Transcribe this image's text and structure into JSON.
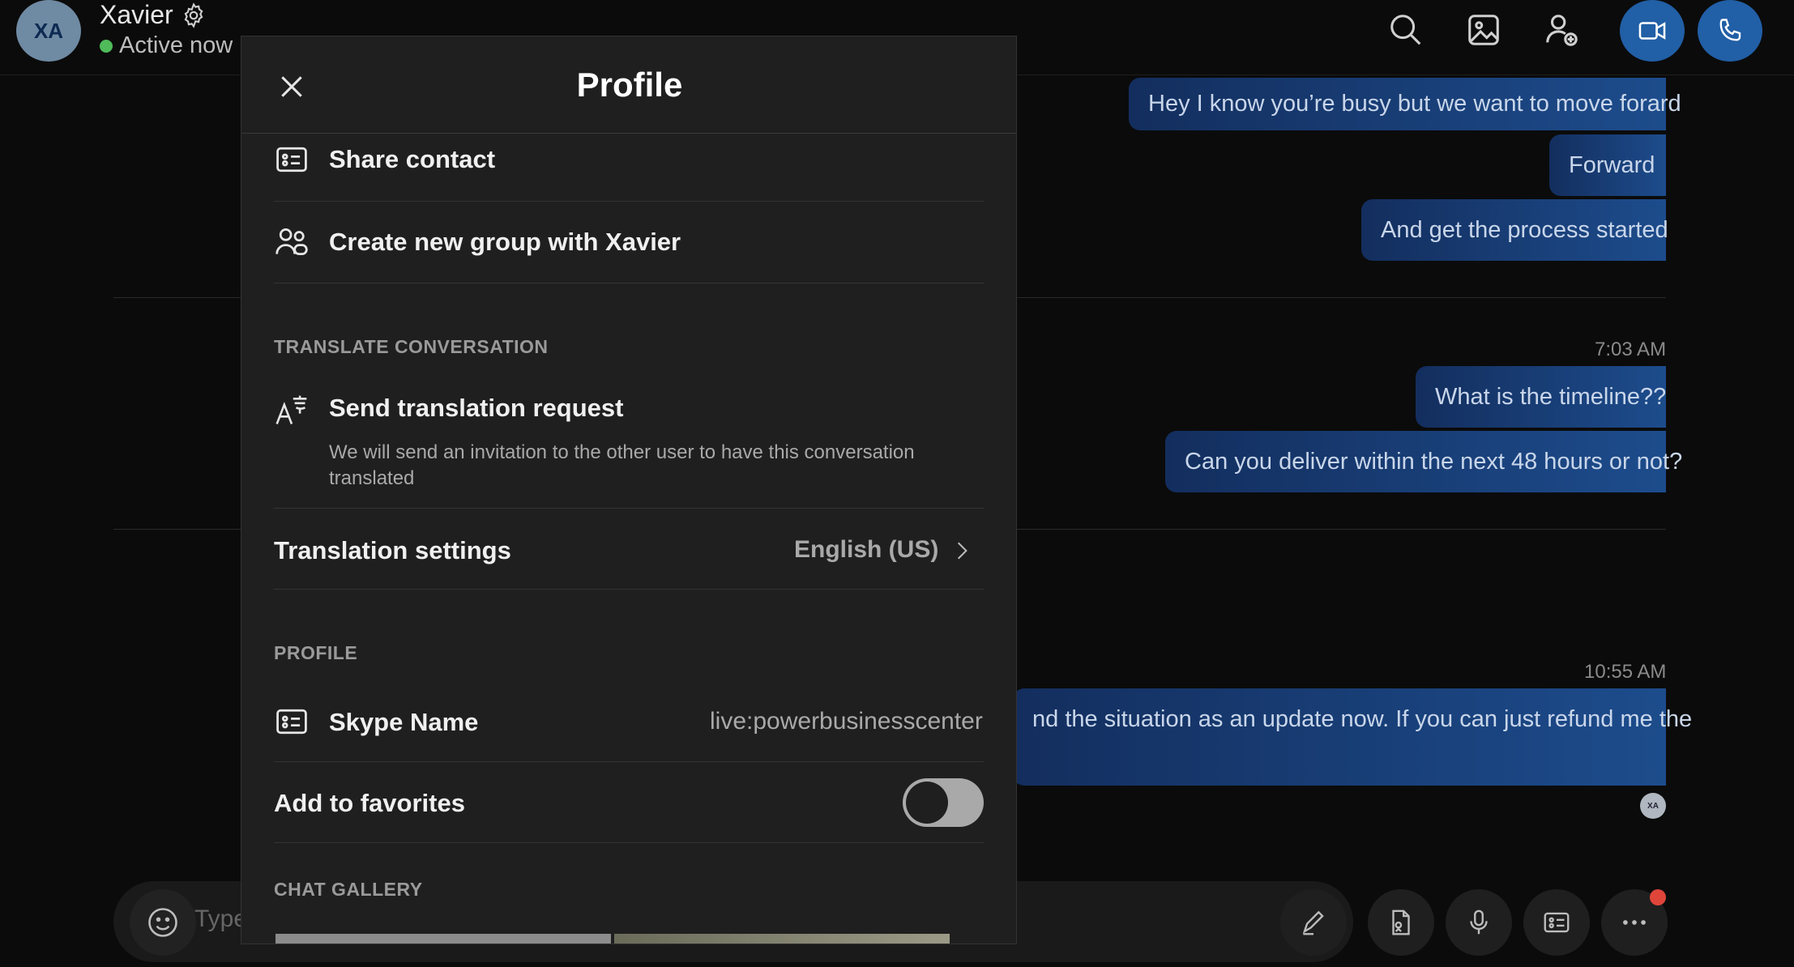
{
  "header": {
    "avatar_initials": "XA",
    "contact_name": "Xavier",
    "status": "Active now",
    "status_color": "#4fbb5a"
  },
  "messages": [
    {
      "text": "Hey I know you’re busy but we want to move forard"
    },
    {
      "text": "Forward"
    },
    {
      "text": "And get the process started"
    },
    {
      "timestamp": "7:03 AM"
    },
    {
      "text": "What is the timeline??"
    },
    {
      "text": "Can you deliver within the next 48 hours or not?"
    },
    {
      "timestamp": "10:55 AM"
    },
    {
      "text": "nd the situation as an update now. If you can just refund me the"
    }
  ],
  "mini_avatar": "XA",
  "composer": {
    "placeholder": "Type"
  },
  "modal": {
    "title": "Profile",
    "share_contact": "Share contact",
    "create_group": "Create new group with Xavier",
    "translate_section": "TRANSLATE CONVERSATION",
    "send_translation": "Send translation request",
    "send_translation_desc": "We will send an invitation to the other user to have this conversation translated",
    "translation_settings": "Translation settings",
    "translation_language": "English (US)",
    "profile_section": "PROFILE",
    "skype_name_label": "Skype Name",
    "skype_name_value": "live:powerbusinesscenter",
    "add_to_favorites": "Add to favorites",
    "favorites_on": false,
    "chat_gallery_section": "CHAT GALLERY"
  },
  "colors": {
    "accent": "#215fa6",
    "notification": "#e0453a"
  }
}
